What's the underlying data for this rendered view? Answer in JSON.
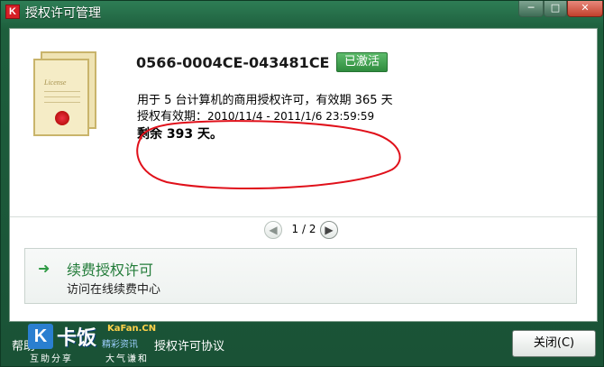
{
  "window": {
    "title": "授权许可管理",
    "app_icon_letter": "K",
    "controls": {
      "minimize": "─",
      "maximize": "□",
      "close": "✕"
    }
  },
  "license": {
    "key": "0566-0004CE-043481CE",
    "status": "已激活",
    "usage_line": "用于 5 台计算机的商用授权许可，有效期 365 天",
    "validity_label": "授权有效期：",
    "validity_range": "2010/11/4 - 2011/1/6 23:59:59",
    "remaining": "剩余 393 天。"
  },
  "certificate": {
    "label": "License"
  },
  "pager": {
    "text": "1 / 2",
    "prev": "◀",
    "next": "▶"
  },
  "renew": {
    "arrow": "➜",
    "title": "续费授权许可",
    "subtitle": "访问在线续费中心"
  },
  "footer": {
    "help": "帮助",
    "agreement": "授权许可协议",
    "close_button": "关闭(C)"
  },
  "watermark": {
    "logo_letter": "K",
    "name": "卡饭",
    "site": "KaFan.CN",
    "sub": "精彩资讯",
    "slogan1": "互助分享",
    "slogan2": "大气谦和"
  },
  "colors": {
    "frame": "#1d5e3c",
    "accent_green": "#2f8c3e",
    "annotation_red": "#e0101a"
  }
}
